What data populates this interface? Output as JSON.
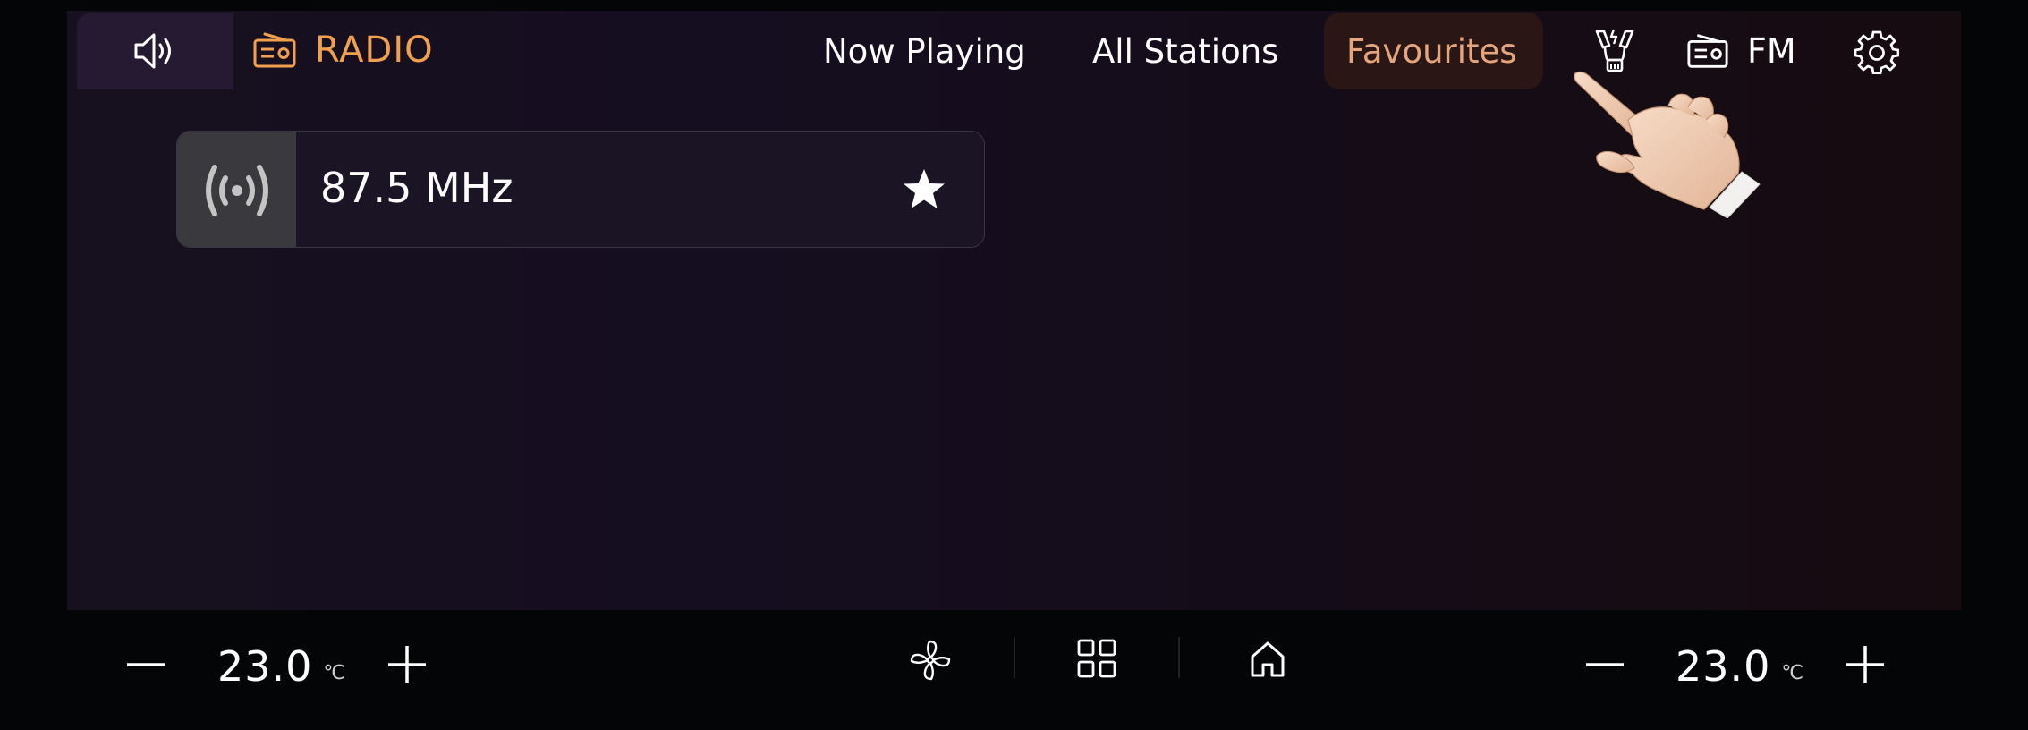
{
  "header": {
    "app_label": "RADIO",
    "tabs": [
      {
        "label": "Now Playing"
      },
      {
        "label": "All Stations"
      },
      {
        "label": "Favourites"
      }
    ],
    "active_tab": "Favourites",
    "band_label": "FM"
  },
  "favourites": [
    {
      "frequency": "87.5 MHz",
      "favourite": true
    }
  ],
  "climate": {
    "left": {
      "temperature": "23.0",
      "unit": "℃"
    },
    "right": {
      "temperature": "23.0",
      "unit": "℃"
    }
  },
  "colors": {
    "accent": "#f0a04f",
    "active_tab_text": "#e6a67d",
    "screen_bg": "#150e20"
  },
  "icons": [
    "volume-icon",
    "radio-icon",
    "ptt-icon",
    "radio-band-icon",
    "settings-icon",
    "broadcast-icon",
    "star-icon",
    "minus-icon",
    "plus-icon",
    "fan-icon",
    "apps-grid-icon",
    "home-icon",
    "pointing-hand-icon"
  ]
}
